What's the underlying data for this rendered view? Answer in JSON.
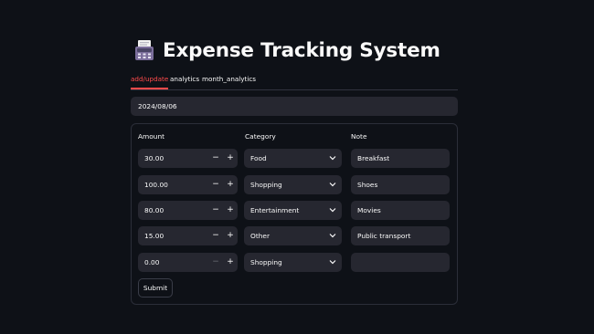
{
  "app": {
    "title": "Expense Tracking System",
    "title_icon": "fax-icon"
  },
  "tabs": [
    {
      "label": "add/update",
      "active": true
    },
    {
      "label": "analytics",
      "active": false
    },
    {
      "label": "month_analytics",
      "active": false
    }
  ],
  "date_input": {
    "value": "2024/08/06"
  },
  "form": {
    "headers": {
      "amount": "Amount",
      "category": "Category",
      "note": "Note"
    },
    "rows": [
      {
        "amount": "30.00",
        "category": "Food",
        "note": "Breakfast",
        "minus_enabled": true
      },
      {
        "amount": "100.00",
        "category": "Shopping",
        "note": "Shoes",
        "minus_enabled": true
      },
      {
        "amount": "80.00",
        "category": "Entertainment",
        "note": "Movies",
        "minus_enabled": true
      },
      {
        "amount": "15.00",
        "category": "Other",
        "note": "Public transport",
        "minus_enabled": true
      },
      {
        "amount": "0.00",
        "category": "Shopping",
        "note": "",
        "minus_enabled": false
      }
    ],
    "stepper": {
      "minus": "−",
      "plus": "+"
    },
    "submit_label": "Submit"
  },
  "colors": {
    "background": "#0e1117",
    "input_bg": "#262730",
    "accent": "#ff4b4b",
    "text": "#fafafa"
  }
}
